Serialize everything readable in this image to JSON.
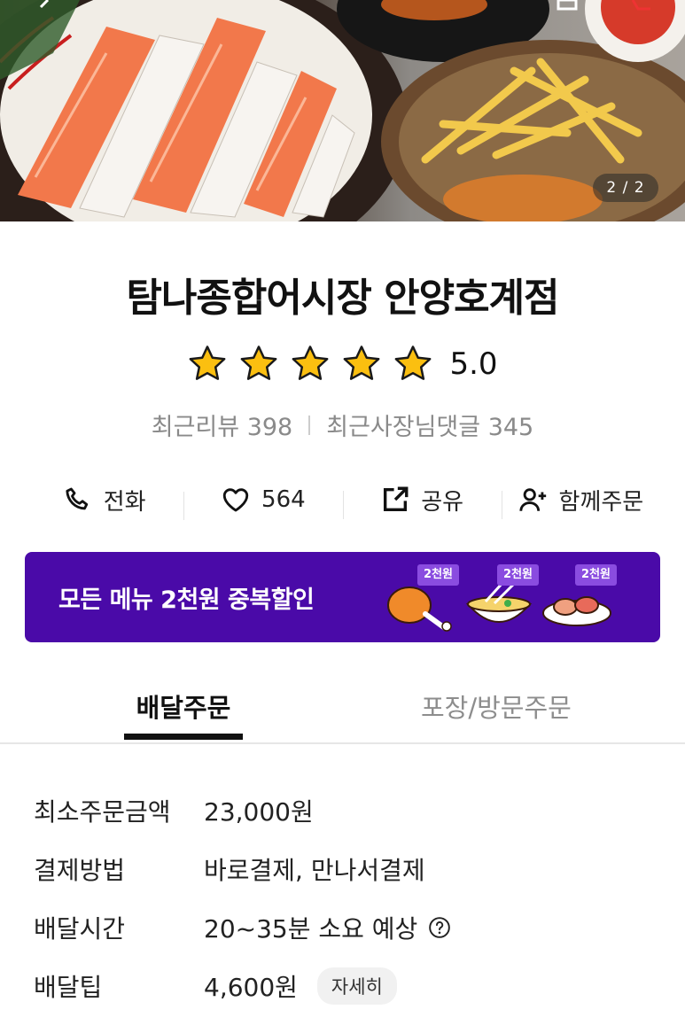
{
  "hero": {
    "image_counter": "2 / 2"
  },
  "store": {
    "name": "탐나종합어시장 안양호계점",
    "rating": 5.0,
    "rating_text": "5.0",
    "star_count": 5,
    "recent_reviews_label": "최근리뷰 398",
    "owner_replies_label": "최근사장님댓글 345"
  },
  "actions": {
    "call_label": "전화",
    "like_count": "564",
    "share_label": "공유",
    "group_order_label": "함께주문"
  },
  "icons": {
    "call": "phone-icon",
    "like": "heart-icon",
    "share": "share-icon",
    "group": "add-person-icon",
    "help": "question-circle-icon"
  },
  "banner": {
    "text": "모든 메뉴 2천원 중복할인",
    "coupons": [
      "2천원",
      "2천원",
      "2천원"
    ],
    "color": "#4a0aa8"
  },
  "tabs": {
    "delivery": "배달주문",
    "pickup": "포장/방문주문",
    "active": "delivery"
  },
  "info": {
    "min_order_label": "최소주문금액",
    "min_order_value": "23,000원",
    "payment_label": "결제방법",
    "payment_value": "바로결제, 만나서결제",
    "delivery_time_label": "배달시간",
    "delivery_time_value": "20~35분 소요 예상",
    "delivery_tip_label": "배달팁",
    "delivery_tip_value": "4,600원",
    "detail_button": "자세히"
  }
}
